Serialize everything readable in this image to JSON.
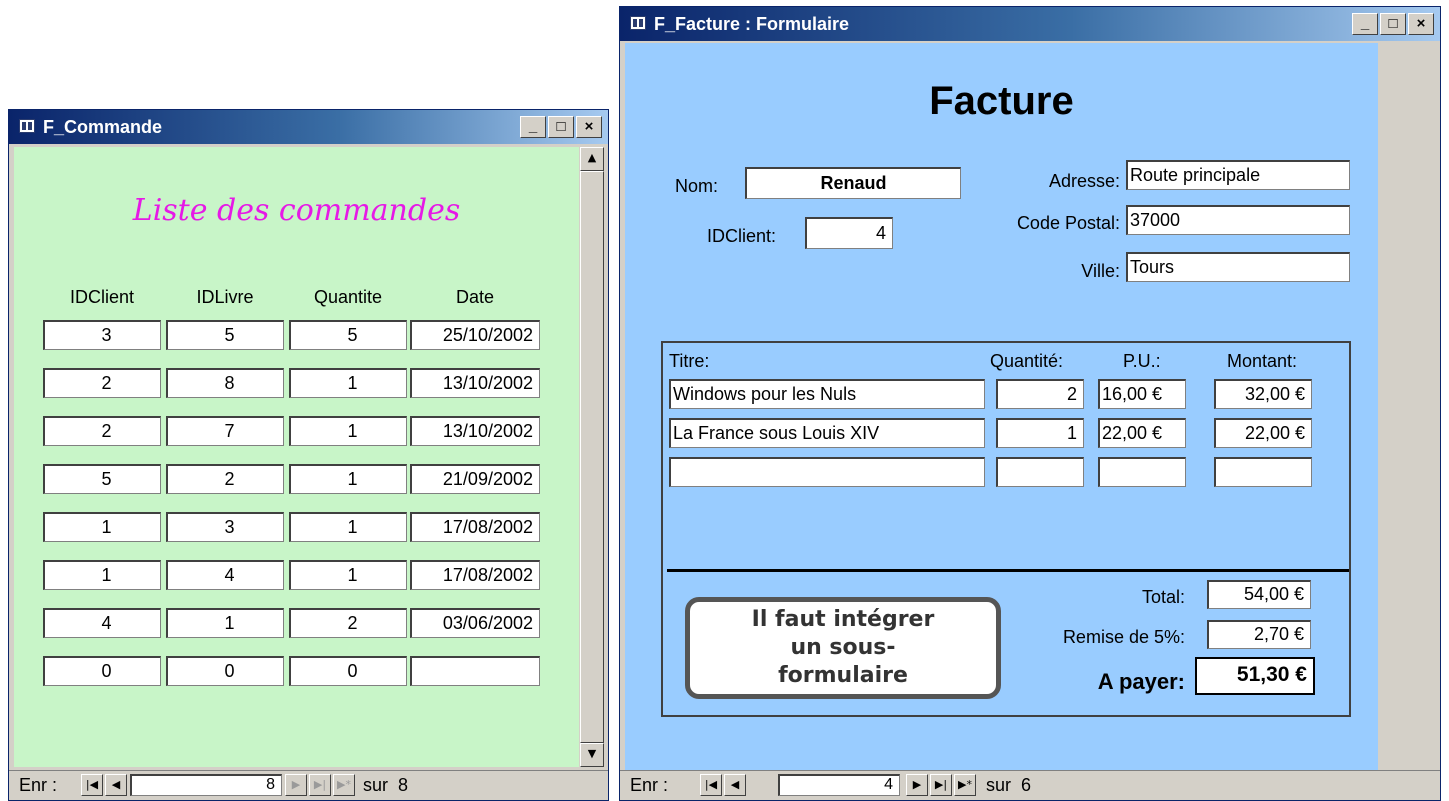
{
  "commande": {
    "title": "F_Commande",
    "heading": "Liste des commandes",
    "columns": [
      "IDClient",
      "IDLivre",
      "Quantite",
      "Date"
    ],
    "rows": [
      {
        "idclient": "3",
        "idlivre": "5",
        "quantite": "5",
        "date": "25/10/2002"
      },
      {
        "idclient": "2",
        "idlivre": "8",
        "quantite": "1",
        "date": "13/10/2002"
      },
      {
        "idclient": "2",
        "idlivre": "7",
        "quantite": "1",
        "date": "13/10/2002"
      },
      {
        "idclient": "5",
        "idlivre": "2",
        "quantite": "1",
        "date": "21/09/2002"
      },
      {
        "idclient": "1",
        "idlivre": "3",
        "quantite": "1",
        "date": "17/08/2002"
      },
      {
        "idclient": "1",
        "idlivre": "4",
        "quantite": "1",
        "date": "17/08/2002"
      },
      {
        "idclient": "4",
        "idlivre": "1",
        "quantite": "2",
        "date": "03/06/2002"
      },
      {
        "idclient": "0",
        "idlivre": "0",
        "quantite": "0",
        "date": ""
      }
    ],
    "nav": {
      "label": "Enr :",
      "current": "8",
      "of_label": "sur",
      "total": "8"
    },
    "colors": {
      "background": "#c8f5c8",
      "heading": "#e619e6"
    }
  },
  "facture": {
    "title": "F_Facture : Formulaire",
    "heading": "Facture",
    "nom_label": "Nom:",
    "nom_value": "Renaud",
    "idclient_label": "IDClient:",
    "idclient_value": "4",
    "adresse_label": "Adresse:",
    "adresse_value": "Route principale",
    "codepostal_label": "Code Postal:",
    "codepostal_value": "37000",
    "ville_label": "Ville:",
    "ville_value": "Tours",
    "sub": {
      "headers": {
        "titre": "Titre:",
        "quantite": "Quantité:",
        "pu": "P.U.:",
        "montant": "Montant:"
      },
      "rows": [
        {
          "titre": "Windows pour les Nuls",
          "quantite": "2",
          "pu": "16,00 €",
          "montant": "32,00 €"
        },
        {
          "titre": "La France sous Louis XIV",
          "quantite": "1",
          "pu": "22,00 €",
          "montant": "22,00 €"
        },
        {
          "titre": "",
          "quantite": "",
          "pu": "",
          "montant": ""
        }
      ]
    },
    "total_label": "Total:",
    "total_value": "54,00 €",
    "remise_label": "Remise de 5%:",
    "remise_value": "2,70 €",
    "apayer_label": "A payer:",
    "apayer_value": "51,30 €",
    "callout": "Il faut intégrer un sous-formulaire",
    "nav": {
      "label": "Enr :",
      "current": "4",
      "of_label": "sur",
      "total": "6"
    },
    "colors": {
      "background": "#99ccff"
    }
  },
  "icons": [
    "form-icon",
    "minimize-icon",
    "maximize-icon",
    "close-icon",
    "scroll-up-arrow-icon",
    "scroll-down-arrow-icon",
    "first-record-icon",
    "previous-record-icon",
    "next-record-icon",
    "last-record-icon",
    "new-record-icon"
  ]
}
